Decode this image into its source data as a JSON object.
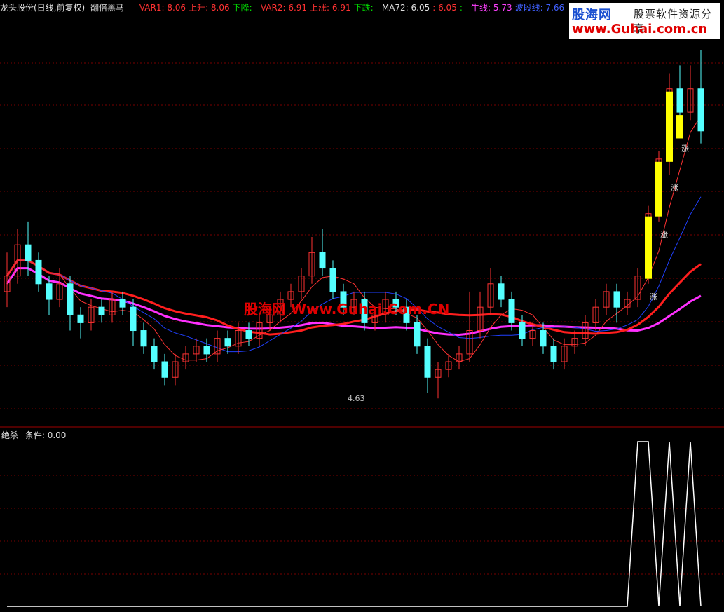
{
  "header": {
    "stock": "龙头股份(日线,前复权)",
    "indicator": "翻倍黑马",
    "items": [
      {
        "label": "VAR1: 8.06",
        "color": "#ff3232"
      },
      {
        "label": "上升: 8.06",
        "color": "#ff3232"
      },
      {
        "label": "下降: -",
        "color": "#00e000"
      },
      {
        "label": "VAR2: 6.91",
        "color": "#ff3232"
      },
      {
        "label": "上涨: 6.91",
        "color": "#ff3232"
      },
      {
        "label": "下跌: -",
        "color": "#00e000"
      },
      {
        "label": "MA72: 6.05",
        "color": "#e0e0e0"
      },
      {
        "label": ": 6.05",
        "color": "#ff3232"
      },
      {
        "label": ": -",
        "color": "#00e000"
      },
      {
        "label": "牛线: 5.73",
        "color": "#ff40ff"
      },
      {
        "label": "波段线: 7.66",
        "color": "#4060ff"
      }
    ]
  },
  "logo": {
    "cn": "股海网",
    "slogan": "股票软件资源分享",
    "url": "www.Guhai.com.cn"
  },
  "watermark": "股海网 Www.Guhai.Com.CN",
  "low_label": "4.63",
  "sub_header": {
    "name": "绝杀",
    "cond": "条件: 0.00"
  },
  "signal_label": "涨",
  "colors": {
    "up": "#ff3232",
    "down": "#54ffff",
    "yellow": "#ffff00",
    "green_line": "#32e632",
    "red_line": "#ff1e1e",
    "magenta_line": "#ff30ff",
    "blue_line": "#2040ff",
    "grid": "#7a0000"
  },
  "chart_data": {
    "type": "candlestick",
    "candles": [
      [
        6.0,
        6.2,
        6.5,
        5.8
      ],
      [
        6.2,
        6.6,
        6.8,
        6.1
      ],
      [
        6.6,
        6.4,
        6.9,
        6.2
      ],
      [
        6.4,
        6.1,
        6.5,
        6.0
      ],
      [
        6.1,
        5.9,
        6.2,
        5.7
      ],
      [
        5.9,
        6.1,
        6.3,
        5.8
      ],
      [
        6.1,
        5.7,
        6.2,
        5.5
      ],
      [
        5.7,
        5.6,
        5.8,
        5.4
      ],
      [
        5.6,
        5.8,
        5.9,
        5.5
      ],
      [
        5.8,
        5.7,
        5.9,
        5.6
      ],
      [
        5.7,
        5.9,
        6.0,
        5.6
      ],
      [
        5.9,
        5.8,
        6.0,
        5.7
      ],
      [
        5.8,
        5.5,
        5.9,
        5.3
      ],
      [
        5.5,
        5.3,
        5.6,
        5.2
      ],
      [
        5.3,
        5.1,
        5.4,
        5.0
      ],
      [
        5.1,
        4.9,
        5.2,
        4.8
      ],
      [
        4.9,
        5.1,
        5.2,
        4.8
      ],
      [
        5.1,
        5.2,
        5.3,
        5.0
      ],
      [
        5.2,
        5.3,
        5.4,
        5.1
      ],
      [
        5.3,
        5.2,
        5.4,
        5.1
      ],
      [
        5.2,
        5.4,
        5.5,
        5.1
      ],
      [
        5.4,
        5.3,
        5.5,
        5.2
      ],
      [
        5.3,
        5.5,
        5.6,
        5.2
      ],
      [
        5.5,
        5.4,
        5.6,
        5.3
      ],
      [
        5.4,
        5.6,
        5.7,
        5.3
      ],
      [
        5.6,
        5.7,
        5.8,
        5.5
      ],
      [
        5.7,
        5.9,
        6.0,
        5.6
      ],
      [
        5.9,
        6.0,
        6.1,
        5.8
      ],
      [
        6.0,
        6.2,
        6.3,
        5.9
      ],
      [
        6.2,
        6.5,
        6.7,
        6.1
      ],
      [
        6.5,
        6.3,
        6.8,
        6.2
      ],
      [
        6.3,
        6.0,
        6.4,
        5.9
      ],
      [
        6.0,
        5.8,
        6.1,
        5.7
      ],
      [
        5.8,
        5.9,
        6.0,
        5.7
      ],
      [
        5.9,
        5.6,
        6.0,
        5.5
      ],
      [
        5.6,
        5.7,
        5.8,
        5.5
      ],
      [
        5.7,
        5.9,
        6.0,
        5.6
      ],
      [
        5.9,
        5.8,
        6.0,
        5.7
      ],
      [
        5.8,
        5.6,
        5.9,
        5.5
      ],
      [
        5.6,
        5.3,
        5.7,
        5.2
      ],
      [
        5.3,
        4.9,
        5.4,
        4.7
      ],
      [
        4.9,
        5.0,
        5.1,
        4.63
      ],
      [
        5.0,
        5.1,
        5.2,
        4.9
      ],
      [
        5.1,
        5.2,
        5.3,
        5.0
      ],
      [
        5.2,
        5.5,
        6.0,
        5.1
      ],
      [
        5.5,
        5.8,
        6.0,
        5.4
      ],
      [
        5.8,
        6.1,
        6.3,
        5.7
      ],
      [
        6.1,
        5.9,
        6.2,
        5.8
      ],
      [
        5.9,
        5.6,
        6.0,
        5.5
      ],
      [
        5.6,
        5.4,
        5.7,
        5.3
      ],
      [
        5.4,
        5.5,
        5.6,
        5.3
      ],
      [
        5.5,
        5.3,
        5.6,
        5.2
      ],
      [
        5.3,
        5.1,
        5.4,
        5.0
      ],
      [
        5.1,
        5.3,
        5.4,
        5.0
      ],
      [
        5.3,
        5.4,
        5.5,
        5.2
      ],
      [
        5.4,
        5.6,
        5.7,
        5.3
      ],
      [
        5.6,
        5.8,
        5.9,
        5.5
      ],
      [
        5.8,
        6.0,
        6.1,
        5.7
      ],
      [
        6.0,
        5.8,
        6.1,
        5.6
      ],
      [
        5.8,
        5.9,
        6.0,
        5.7
      ],
      [
        5.9,
        6.2,
        6.3,
        5.8
      ],
      [
        6.2,
        7.0,
        7.1,
        6.1
      ],
      [
        7.0,
        7.7,
        7.8,
        6.9
      ],
      [
        7.7,
        8.6,
        8.8,
        7.5
      ],
      [
        8.6,
        8.3,
        8.9,
        8.0
      ],
      [
        8.3,
        8.6,
        8.9,
        8.2
      ],
      [
        8.6,
        8.06,
        9.1,
        7.9
      ]
    ],
    "ylim": [
      4.3,
      9.2
    ],
    "price_ticks": [
      4.63
    ],
    "sub_chart": {
      "values": [
        0,
        0,
        0,
        0,
        0,
        0,
        0,
        0,
        0,
        0,
        0,
        0,
        0,
        0,
        0,
        0,
        0,
        0,
        0,
        0,
        0,
        0,
        0,
        0,
        0,
        0,
        0,
        0,
        0,
        0,
        0,
        0,
        0,
        0,
        0,
        0,
        0,
        0,
        0,
        0,
        0,
        0,
        0,
        0,
        0,
        0,
        0,
        0,
        0,
        0,
        0,
        0,
        0,
        0,
        0,
        0,
        0,
        0,
        0,
        0,
        1,
        1,
        0,
        1,
        0,
        1,
        0
      ]
    }
  }
}
